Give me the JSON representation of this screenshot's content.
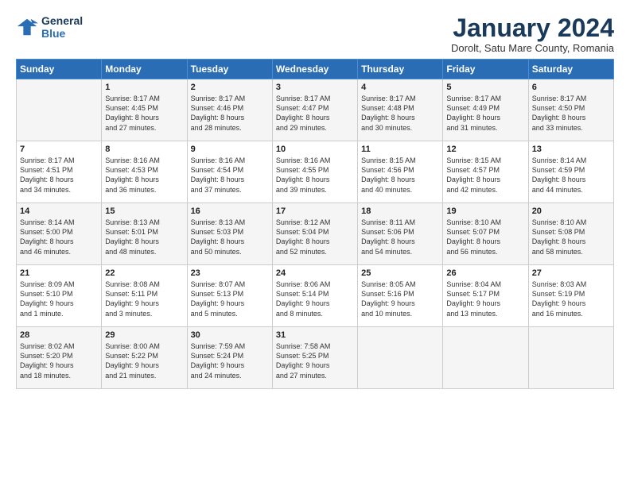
{
  "header": {
    "logo_line1": "General",
    "logo_line2": "Blue",
    "month": "January 2024",
    "location": "Dorolt, Satu Mare County, Romania"
  },
  "weekdays": [
    "Sunday",
    "Monday",
    "Tuesday",
    "Wednesday",
    "Thursday",
    "Friday",
    "Saturday"
  ],
  "weeks": [
    [
      {
        "day": "",
        "content": ""
      },
      {
        "day": "1",
        "content": "Sunrise: 8:17 AM\nSunset: 4:45 PM\nDaylight: 8 hours\nand 27 minutes."
      },
      {
        "day": "2",
        "content": "Sunrise: 8:17 AM\nSunset: 4:46 PM\nDaylight: 8 hours\nand 28 minutes."
      },
      {
        "day": "3",
        "content": "Sunrise: 8:17 AM\nSunset: 4:47 PM\nDaylight: 8 hours\nand 29 minutes."
      },
      {
        "day": "4",
        "content": "Sunrise: 8:17 AM\nSunset: 4:48 PM\nDaylight: 8 hours\nand 30 minutes."
      },
      {
        "day": "5",
        "content": "Sunrise: 8:17 AM\nSunset: 4:49 PM\nDaylight: 8 hours\nand 31 minutes."
      },
      {
        "day": "6",
        "content": "Sunrise: 8:17 AM\nSunset: 4:50 PM\nDaylight: 8 hours\nand 33 minutes."
      }
    ],
    [
      {
        "day": "7",
        "content": "Sunrise: 8:17 AM\nSunset: 4:51 PM\nDaylight: 8 hours\nand 34 minutes."
      },
      {
        "day": "8",
        "content": "Sunrise: 8:16 AM\nSunset: 4:53 PM\nDaylight: 8 hours\nand 36 minutes."
      },
      {
        "day": "9",
        "content": "Sunrise: 8:16 AM\nSunset: 4:54 PM\nDaylight: 8 hours\nand 37 minutes."
      },
      {
        "day": "10",
        "content": "Sunrise: 8:16 AM\nSunset: 4:55 PM\nDaylight: 8 hours\nand 39 minutes."
      },
      {
        "day": "11",
        "content": "Sunrise: 8:15 AM\nSunset: 4:56 PM\nDaylight: 8 hours\nand 40 minutes."
      },
      {
        "day": "12",
        "content": "Sunrise: 8:15 AM\nSunset: 4:57 PM\nDaylight: 8 hours\nand 42 minutes."
      },
      {
        "day": "13",
        "content": "Sunrise: 8:14 AM\nSunset: 4:59 PM\nDaylight: 8 hours\nand 44 minutes."
      }
    ],
    [
      {
        "day": "14",
        "content": "Sunrise: 8:14 AM\nSunset: 5:00 PM\nDaylight: 8 hours\nand 46 minutes."
      },
      {
        "day": "15",
        "content": "Sunrise: 8:13 AM\nSunset: 5:01 PM\nDaylight: 8 hours\nand 48 minutes."
      },
      {
        "day": "16",
        "content": "Sunrise: 8:13 AM\nSunset: 5:03 PM\nDaylight: 8 hours\nand 50 minutes."
      },
      {
        "day": "17",
        "content": "Sunrise: 8:12 AM\nSunset: 5:04 PM\nDaylight: 8 hours\nand 52 minutes."
      },
      {
        "day": "18",
        "content": "Sunrise: 8:11 AM\nSunset: 5:06 PM\nDaylight: 8 hours\nand 54 minutes."
      },
      {
        "day": "19",
        "content": "Sunrise: 8:10 AM\nSunset: 5:07 PM\nDaylight: 8 hours\nand 56 minutes."
      },
      {
        "day": "20",
        "content": "Sunrise: 8:10 AM\nSunset: 5:08 PM\nDaylight: 8 hours\nand 58 minutes."
      }
    ],
    [
      {
        "day": "21",
        "content": "Sunrise: 8:09 AM\nSunset: 5:10 PM\nDaylight: 9 hours\nand 1 minute."
      },
      {
        "day": "22",
        "content": "Sunrise: 8:08 AM\nSunset: 5:11 PM\nDaylight: 9 hours\nand 3 minutes."
      },
      {
        "day": "23",
        "content": "Sunrise: 8:07 AM\nSunset: 5:13 PM\nDaylight: 9 hours\nand 5 minutes."
      },
      {
        "day": "24",
        "content": "Sunrise: 8:06 AM\nSunset: 5:14 PM\nDaylight: 9 hours\nand 8 minutes."
      },
      {
        "day": "25",
        "content": "Sunrise: 8:05 AM\nSunset: 5:16 PM\nDaylight: 9 hours\nand 10 minutes."
      },
      {
        "day": "26",
        "content": "Sunrise: 8:04 AM\nSunset: 5:17 PM\nDaylight: 9 hours\nand 13 minutes."
      },
      {
        "day": "27",
        "content": "Sunrise: 8:03 AM\nSunset: 5:19 PM\nDaylight: 9 hours\nand 16 minutes."
      }
    ],
    [
      {
        "day": "28",
        "content": "Sunrise: 8:02 AM\nSunset: 5:20 PM\nDaylight: 9 hours\nand 18 minutes."
      },
      {
        "day": "29",
        "content": "Sunrise: 8:00 AM\nSunset: 5:22 PM\nDaylight: 9 hours\nand 21 minutes."
      },
      {
        "day": "30",
        "content": "Sunrise: 7:59 AM\nSunset: 5:24 PM\nDaylight: 9 hours\nand 24 minutes."
      },
      {
        "day": "31",
        "content": "Sunrise: 7:58 AM\nSunset: 5:25 PM\nDaylight: 9 hours\nand 27 minutes."
      },
      {
        "day": "",
        "content": ""
      },
      {
        "day": "",
        "content": ""
      },
      {
        "day": "",
        "content": ""
      }
    ]
  ]
}
